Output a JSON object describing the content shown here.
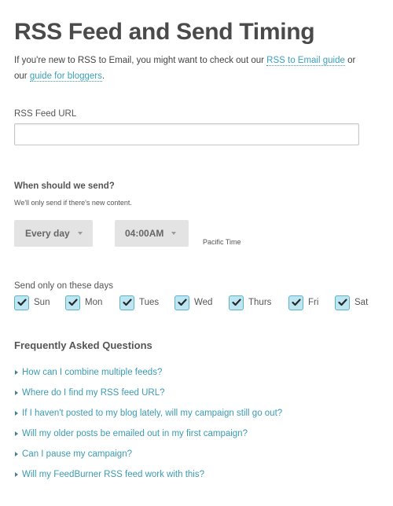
{
  "header": {
    "title": "RSS Feed and Send Timing",
    "intro_prefix": "If you're new to RSS to Email, you might want to check out our ",
    "link_guide": "RSS to Email guide",
    "intro_middle": " or our ",
    "link_bloggers": "guide for bloggers",
    "intro_suffix": "."
  },
  "feed": {
    "label": "RSS Feed URL",
    "value": "",
    "placeholder": ""
  },
  "schedule": {
    "heading": "When should we send?",
    "subtext": "We'll only send if there's new content.",
    "frequency": {
      "selected": "Every day"
    },
    "time": {
      "selected": "04:00AM"
    },
    "timezone": "Pacific Time"
  },
  "days": {
    "label": "Send only on these days",
    "items": [
      {
        "label": "Sun",
        "checked": true
      },
      {
        "label": "Mon",
        "checked": true
      },
      {
        "label": "Tues",
        "checked": true
      },
      {
        "label": "Wed",
        "checked": true
      },
      {
        "label": "Thurs",
        "checked": true
      },
      {
        "label": "Fri",
        "checked": true
      },
      {
        "label": "Sat",
        "checked": true
      }
    ]
  },
  "faq": {
    "heading": "Frequently Asked Questions",
    "items": [
      "How can I combine multiple feeds?",
      "Where do I find my RSS feed URL?",
      "If I haven't posted to my blog lately, will my campaign still go out?",
      "Will my older posts be emailed out in my first campaign?",
      "Can I pause my campaign?",
      "Will my FeedBurner RSS feed work with this?"
    ]
  },
  "colors": {
    "link": "#3ca0b8",
    "checkbox_fill": "#bfe6f0",
    "checkbox_border": "#58b5cc",
    "select_bg": "#e3e3e3",
    "text": "#555555"
  }
}
